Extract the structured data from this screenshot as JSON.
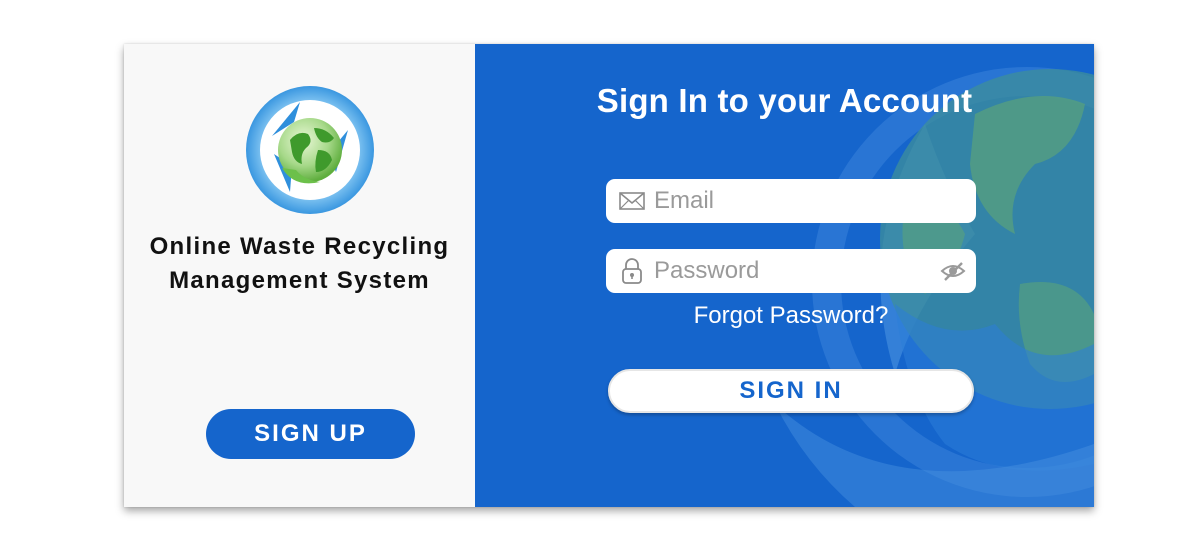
{
  "colors": {
    "brand_blue": "#1565cc",
    "left_panel_bg": "#f8f8f8",
    "text_dark": "#111111",
    "white": "#ffffff"
  },
  "left_panel": {
    "logo_icon": "recycling-globe-icon",
    "system_name_line1": "Online Waste Recycling",
    "system_name_line2": "Management System",
    "signup_label": "SIGN UP"
  },
  "right_panel": {
    "title": "Sign In to your Account",
    "email": {
      "icon": "envelope-icon",
      "placeholder": "Email",
      "value": ""
    },
    "password": {
      "icon": "lock-icon",
      "toggle_icon": "eye-slash-icon",
      "placeholder": "Password",
      "value": ""
    },
    "forgot_label": "Forgot Password?",
    "signin_label": "SIGN IN",
    "background_icon": "globe-watermark-icon"
  }
}
